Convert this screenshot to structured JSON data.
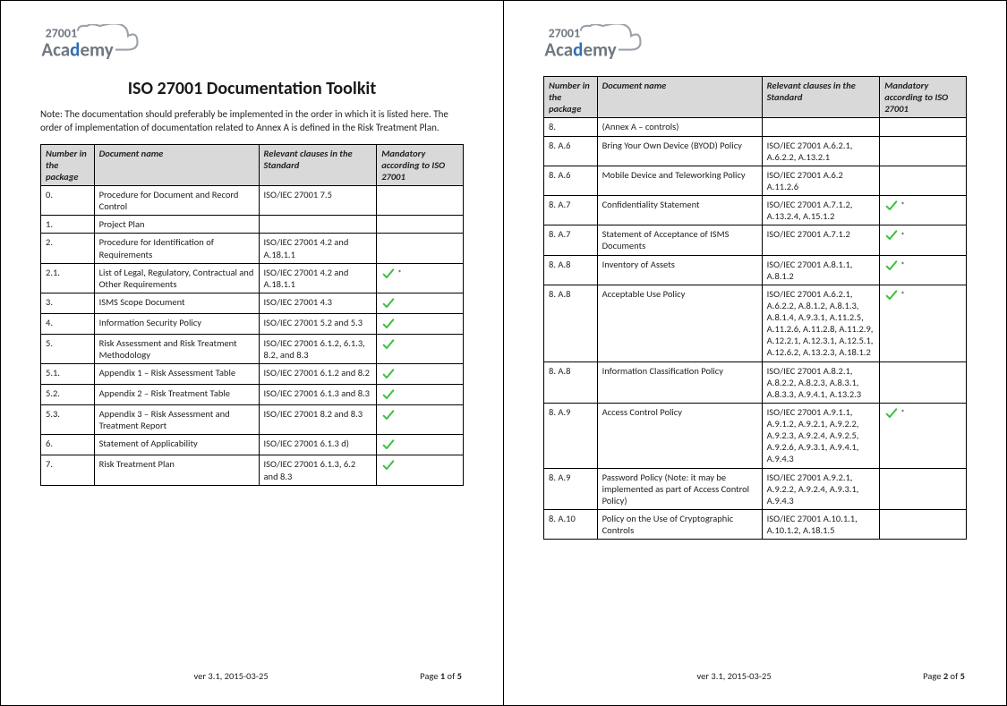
{
  "brand": {
    "top_text": "27001",
    "bottom_text": "Academy"
  },
  "title": "ISO 27001 Documentation Toolkit",
  "note": "Note: The documentation should preferably be implemented in the order in which it is listed here. The order of implementation of documentation related to Annex A is defined in the Risk Treatment Plan.",
  "headers": {
    "num": "Number in the package",
    "name": "Document name",
    "rel": "Relevant clauses in the Standard",
    "mand": "Mandatory according to ISO 27001"
  },
  "footer": {
    "version": "ver 3.1, 2015-03-25",
    "page1": {
      "label": "Page",
      "cur": "1",
      "of": "of",
      "tot": "5"
    },
    "page2": {
      "label": "Page",
      "cur": "2",
      "of": "of",
      "tot": "5"
    }
  },
  "page1_rows": [
    {
      "num": "0.",
      "name": "Procedure for Document and Record Control",
      "rel": "ISO/IEC 27001 7.5",
      "mand": ""
    },
    {
      "num": "1.",
      "name": "Project Plan",
      "rel": "",
      "mand": ""
    },
    {
      "num": "2.",
      "name": "Procedure for Identification of Requirements",
      "rel": "ISO/IEC 27001 4.2 and A.18.1.1",
      "mand": ""
    },
    {
      "num": "2.1.",
      "name": "List of Legal, Regulatory, Contractual and Other Requirements",
      "rel": "ISO/IEC 27001 4.2 and A.18.1.1",
      "mand": "check-star"
    },
    {
      "num": "3.",
      "name": "ISMS Scope Document",
      "rel": "ISO/IEC 27001 4.3",
      "mand": "check"
    },
    {
      "num": "4.",
      "name": "Information Security Policy",
      "rel": "ISO/IEC 27001 5.2 and 5.3",
      "mand": "check"
    },
    {
      "num": "5.",
      "name": "Risk Assessment and Risk Treatment Methodology",
      "rel": "ISO/IEC 27001 6.1.2, 6.1.3, 8.2, and 8.3",
      "mand": "check"
    },
    {
      "num": "5.1.",
      "name": "Appendix 1 – Risk Assessment Table",
      "rel": "ISO/IEC 27001 6.1.2 and 8.2",
      "mand": "check"
    },
    {
      "num": "5.2.",
      "name": "Appendix 2 – Risk Treatment Table",
      "rel": "ISO/IEC 27001 6.1.3 and 8.3",
      "mand": "check"
    },
    {
      "num": "5.3.",
      "name": "Appendix 3 – Risk Assessment and Treatment Report",
      "rel": "ISO/IEC 27001 8.2 and 8.3",
      "mand": "check"
    },
    {
      "num": "6.",
      "name": "Statement of Applicability",
      "rel": "ISO/IEC 27001 6.1.3 d)",
      "mand": "check"
    },
    {
      "num": "7.",
      "name": "Risk Treatment Plan",
      "rel": "ISO/IEC 27001 6.1.3, 6.2 and 8.3",
      "mand": "check"
    }
  ],
  "page2_rows": [
    {
      "num": "8.",
      "name": "(Annex A – controls)",
      "rel": "",
      "mand": ""
    },
    {
      "num": "8. A.6",
      "name": "Bring Your Own Device (BYOD) Policy",
      "rel": "ISO/IEC 27001 A.6.2.1, A.6.2.2, A.13.2.1",
      "mand": ""
    },
    {
      "num": "8. A.6",
      "name": "Mobile Device and Teleworking Policy",
      "rel": "ISO/IEC 27001 A.6.2 A.11.2.6",
      "mand": ""
    },
    {
      "num": "8. A.7",
      "name": "Confidentiality Statement",
      "rel": "ISO/IEC 27001 A.7.1.2, A.13.2.4, A.15.1.2",
      "mand": "check-star"
    },
    {
      "num": "8. A.7",
      "name": "Statement of Acceptance of ISMS Documents",
      "rel": "ISO/IEC 27001 A.7.1.2",
      "mand": "check-star"
    },
    {
      "num": "8. A.8",
      "name": "Inventory of Assets",
      "rel": "ISO/IEC 27001 A.8.1.1, A.8.1.2",
      "mand": "check-star"
    },
    {
      "num": "8. A.8",
      "name": "Acceptable Use Policy",
      "rel": "ISO/IEC 27001 A.6.2.1, A.6.2.2, A.8.1.2, A.8.1.3, A.8.1.4, A.9.3.1, A.11.2.5, A.11.2.6, A.11.2.8, A.11.2.9, A.12.2.1, A.12.3.1, A.12.5.1, A.12.6.2, A.13.2.3, A.18.1.2",
      "mand": "check-star"
    },
    {
      "num": "8. A.8",
      "name": "Information Classification Policy",
      "rel": "ISO/IEC 27001 A.8.2.1, A.8.2.2, A.8.2.3, A.8.3.1, A.8.3.3, A.9.4.1, A.13.2.3",
      "mand": ""
    },
    {
      "num": "8. A.9",
      "name": "Access Control Policy",
      "rel": "ISO/IEC 27001 A.9.1.1, A.9.1.2, A.9.2.1, A.9.2.2, A.9.2.3, A.9.2.4, A.9.2.5, A.9.2.6, A.9.3.1, A.9.4.1, A.9.4.3",
      "mand": "check-star"
    },
    {
      "num": "8. A.9",
      "name": "Password Policy (Note: it may be implemented as part of Access Control Policy)",
      "rel": "ISO/IEC 27001 A.9.2.1, A.9.2.2, A.9.2.4, A.9.3.1, A.9.4.3",
      "mand": ""
    },
    {
      "num": "8. A.10",
      "name": "Policy on the Use of Cryptographic Controls",
      "rel": "ISO/IEC 27001 A.10.1.1, A.10.1.2, A.18.1.5",
      "mand": ""
    }
  ]
}
